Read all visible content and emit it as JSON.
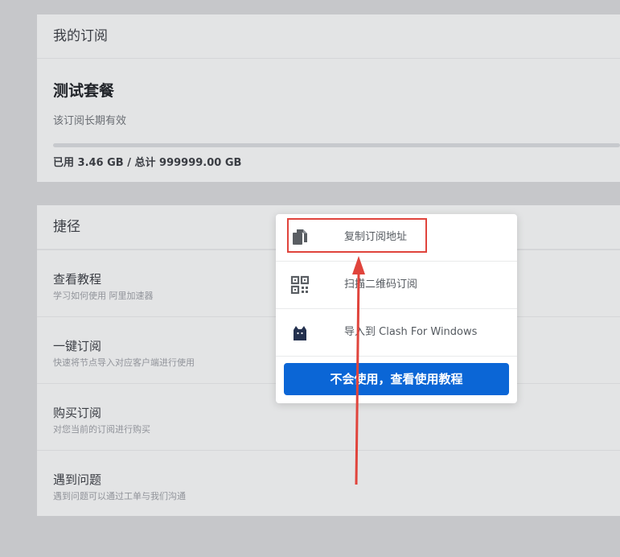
{
  "subscription": {
    "header": "我的订阅",
    "plan_name": "测试套餐",
    "validity": "该订阅长期有效",
    "usage_text": "已用 3.46 GB / 总计 999999.00 GB",
    "usage_fraction": 3.5e-06
  },
  "shortcuts": {
    "header": "捷径",
    "items": [
      {
        "title": "查看教程",
        "desc": "学习如何使用 阿里加速器"
      },
      {
        "title": "一键订阅",
        "desc": "快速将节点导入对应客户端进行使用"
      },
      {
        "title": "购买订阅",
        "desc": "对您当前的订阅进行购买"
      },
      {
        "title": "遇到问题",
        "desc": "遇到问题可以通过工单与我们沟通"
      }
    ]
  },
  "popup": {
    "items": [
      {
        "label": "复制订阅地址",
        "icon": "copy-icon"
      },
      {
        "label": "扫描二维码订阅",
        "icon": "qrcode-icon"
      },
      {
        "label": "导入到 Clash For Windows",
        "icon": "cat-icon"
      }
    ],
    "tutorial_button": "不会使用，查看使用教程"
  },
  "colors": {
    "accent": "#0b66d6",
    "annotation": "#e0443c"
  }
}
